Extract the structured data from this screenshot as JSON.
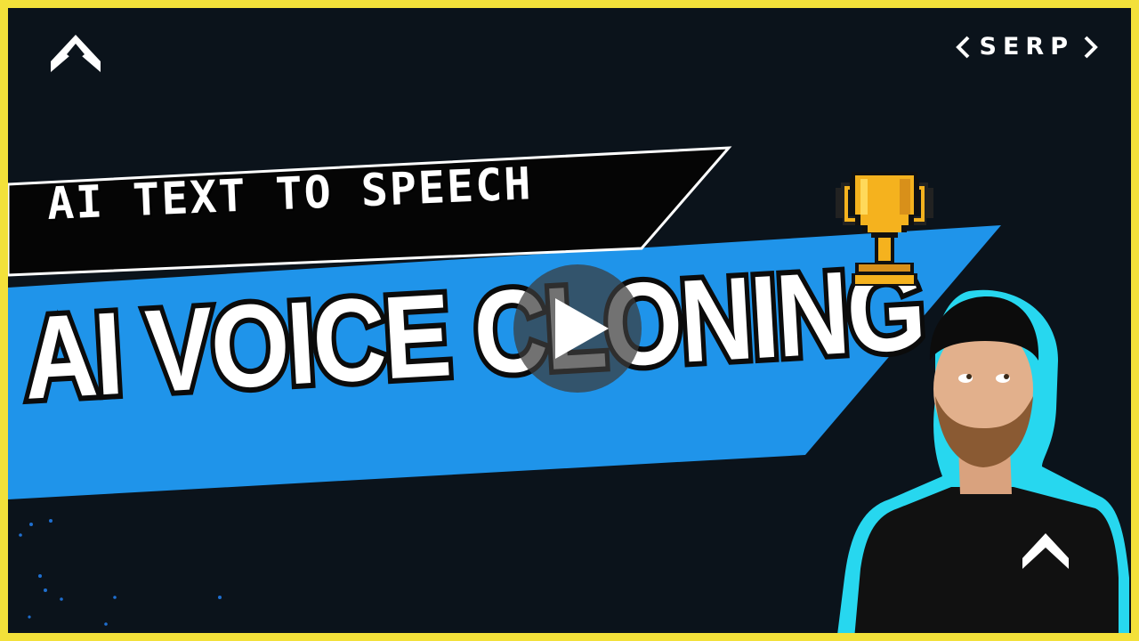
{
  "thumbnail": {
    "subtitle": "AI TEXT TO SPEECH",
    "headline": "AI VOICE CLONING",
    "brand_name": "SERP"
  },
  "icons": {
    "logo": "chevron-up-logo-icon",
    "play": "play-icon",
    "trophy": "trophy-icon"
  },
  "colors": {
    "border": "#f3e13a",
    "background": "#0b131b",
    "banner_blue": "#1f94ea",
    "headline_fill": "#ffffff",
    "trophy_gold": "#f5b21e",
    "outline_cyan": "#27d7ef"
  }
}
